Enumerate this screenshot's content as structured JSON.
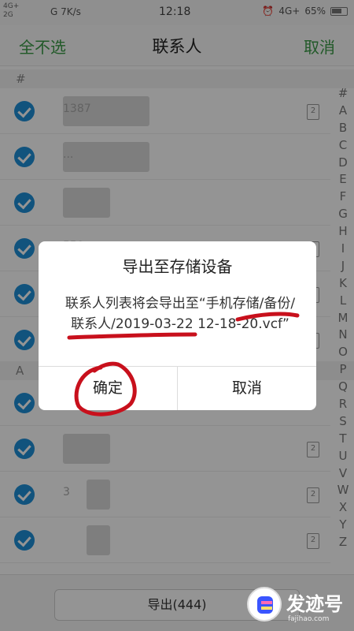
{
  "status_bar": {
    "signal_left": "4G+\n2G",
    "signal_mid": "G 7K/s",
    "time": "12:18",
    "network_right": "4G+",
    "battery": "65%"
  },
  "header": {
    "left_action": "全不选",
    "title": "联系人",
    "right_action": "取消"
  },
  "sections": [
    {
      "label": "#"
    },
    {
      "label": "A"
    }
  ],
  "rows": [
    {
      "name": "1387",
      "sim": "2"
    },
    {
      "name": "...",
      "sim": ""
    },
    {
      "name": "",
      "sim": ""
    },
    {
      "name": "550",
      "sim": "2"
    },
    {
      "name": "",
      "sim": "2"
    },
    {
      "name": "",
      "sim": "2"
    },
    {
      "name": "",
      "sim": ""
    },
    {
      "name": "",
      "sim": "2"
    },
    {
      "name": "3",
      "sim": "2"
    },
    {
      "name": "",
      "sim": "2"
    },
    {
      "name": "",
      "sim": ""
    }
  ],
  "index_letters": [
    "#",
    "A",
    "B",
    "C",
    "D",
    "E",
    "F",
    "G",
    "H",
    "I",
    "J",
    "K",
    "L",
    "M",
    "N",
    "O",
    "P",
    "Q",
    "R",
    "S",
    "T",
    "U",
    "V",
    "W",
    "X",
    "Y",
    "Z"
  ],
  "bottom": {
    "export_label": "导出(444)"
  },
  "dialog": {
    "title": "导出至存储设备",
    "message": "联系人列表将会导出至“手机存储/备份/联系人/2019-03-22 12-18-20.vcf”",
    "ok_label": "确定",
    "cancel_label": "取消"
  },
  "watermark": {
    "brand": "发迹号",
    "site": "fajihao.com"
  },
  "colors": {
    "accent_green": "#3a9a46",
    "check_blue": "#1e8fd8",
    "annotation_red": "#c8101c"
  }
}
